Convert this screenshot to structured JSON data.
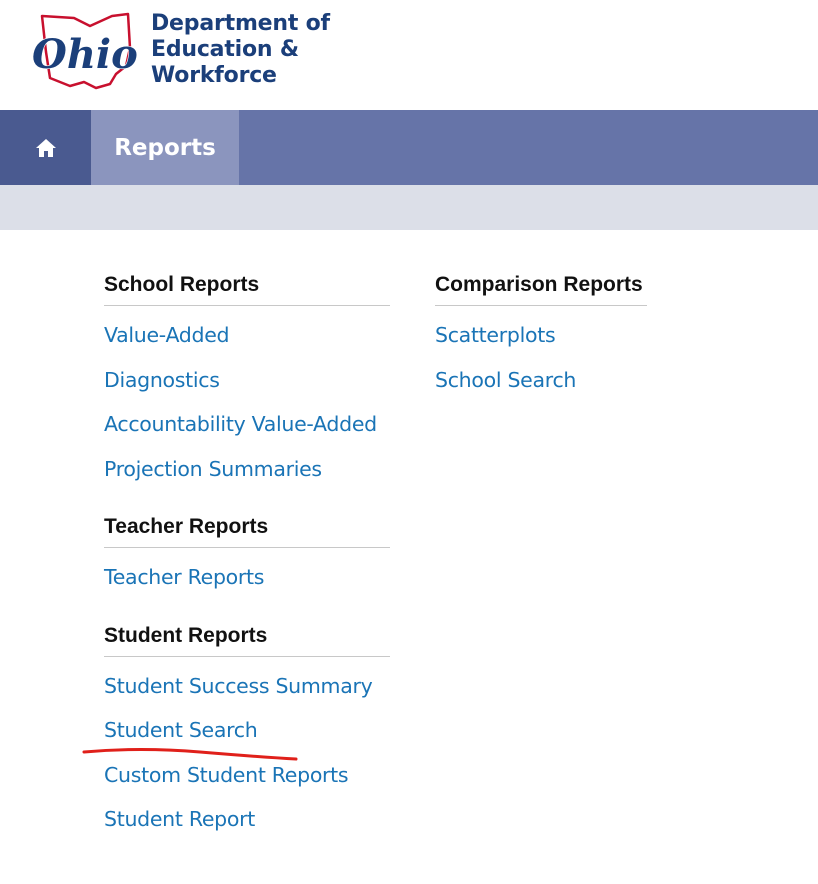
{
  "header": {
    "logo_text": "Ohio",
    "agency_lines": [
      "Department of",
      "Education &",
      "Workforce"
    ]
  },
  "nav": {
    "home_icon": "home-icon",
    "tabs": [
      {
        "label": "Reports"
      }
    ]
  },
  "columns": [
    {
      "sections": [
        {
          "title": "School Reports",
          "links": [
            "Value-Added",
            "Diagnostics",
            "Accountability Value-Added",
            "Projection Summaries"
          ]
        },
        {
          "title": "Teacher Reports",
          "links": [
            "Teacher Reports"
          ]
        },
        {
          "title": "Student Reports",
          "links": [
            "Student Success Summary",
            "Student Search",
            "Custom Student Reports",
            "Student Report"
          ]
        }
      ]
    },
    {
      "sections": [
        {
          "title": "Comparison Reports",
          "links": [
            "Scatterplots",
            "School Search"
          ]
        }
      ]
    }
  ],
  "colors": {
    "brand_navy": "#1b3f7a",
    "logo_red": "#c8102e",
    "nav_bar": "#6674a8",
    "nav_home": "#4a5a90",
    "nav_active_tab": "#8b95be",
    "sub_bar": "#dcdfe8",
    "link": "#1a74b6",
    "annotation_underline": "#e0201a"
  }
}
